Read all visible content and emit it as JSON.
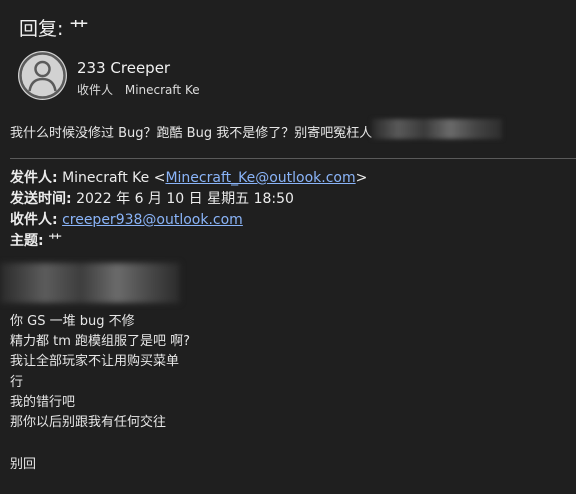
{
  "subject": "回复: 艹",
  "sender_name": "233 Creeper",
  "recipients_label": "收件人",
  "recipient_name": "Minecraft Ke",
  "reply_body": "我什么时候没修过 Bug？跑酷 Bug 我不是修了？别寄吧冤枉人",
  "quoted": {
    "from_label": "发件人:",
    "from_name": "Minecraft Ke <",
    "from_email": "Minecraft_Ke@outlook.com",
    "from_end": ">",
    "sent_label": "发送时间:",
    "sent_value": "2022 年 6 月 10 日 星期五 18:50",
    "to_label": "收件人:",
    "to_email": "creeper938@outlook.com",
    "subject_label": "主题:",
    "subject_value": "艹"
  },
  "body_lines": [
    "你 GS 一堆 bug 不修",
    "精力都 tm 跑模组服了是吧 啊?",
    "我让全部玩家不让用购买菜单",
    "行",
    "我的错行吧",
    "那你以后别跟我有任何交往",
    "别回"
  ]
}
